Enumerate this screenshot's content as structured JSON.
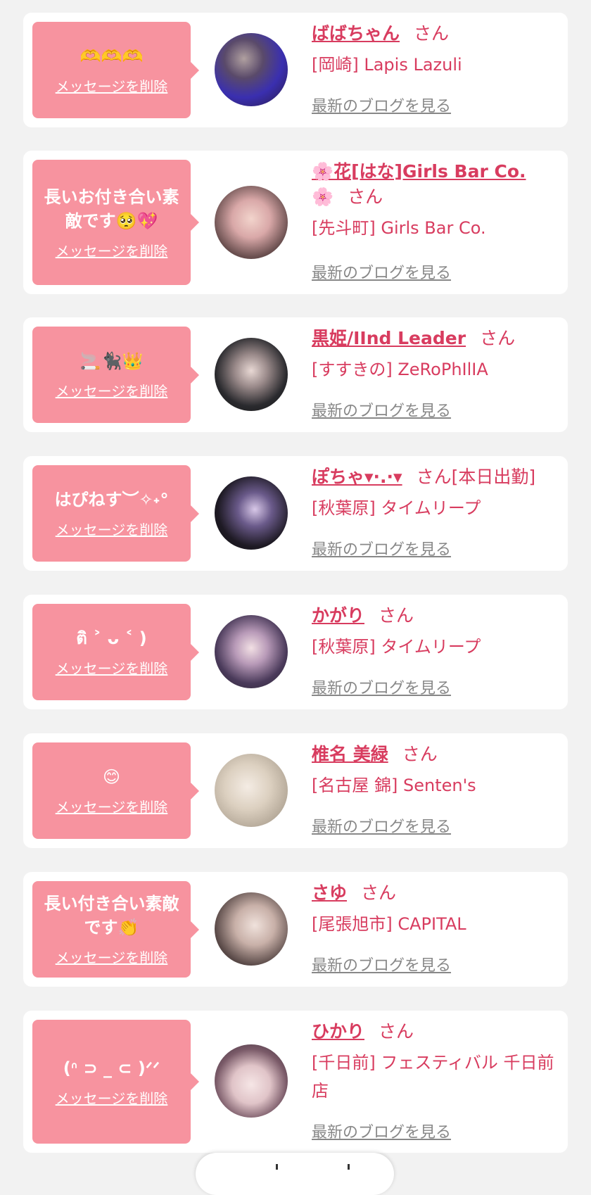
{
  "delete_label": "メッセージを削除",
  "san_label": "さん",
  "blog_label": "最新のブログを見る",
  "cards": [
    {
      "message": "🫶🫶🫶",
      "name": "ばばちゃん",
      "name_suffix": "",
      "badge": "",
      "shop": "[岡崎] Lapis Lazuli"
    },
    {
      "message": "長いお付き合い素敵です🥺💖",
      "name": "🌸花[はな]Girls Bar Co.",
      "name_suffix": "🌸",
      "badge": "",
      "shop": "[先斗町] Girls Bar Co."
    },
    {
      "message": "🚬🐈‍⬛👑",
      "name": "黒姫/IInd Leader",
      "name_suffix": "",
      "badge": "",
      "shop": "[すすきの] ZeRoPhIlIA"
    },
    {
      "message": "はぴねす︶✧˖°",
      "name": "ぽちゃ▾·.·▾",
      "name_suffix": "",
      "badge": "[本日出勤]",
      "shop": "[秋葉原] タイムリープ"
    },
    {
      "message": "ติ ˃ ᴗ ˂ )",
      "name": "かがり",
      "name_suffix": "",
      "badge": "",
      "shop": "[秋葉原] タイムリープ"
    },
    {
      "message": "😊",
      "name": "椎名 美緑",
      "name_suffix": "",
      "badge": "",
      "shop": "[名古屋 錦] Senten's"
    },
    {
      "message": "長い付き合い素敵です👏",
      "name": "さゆ",
      "name_suffix": "",
      "badge": "",
      "shop": "[尾張旭市] CAPITAL"
    },
    {
      "message": "(ᐢ ⊃ _ ⊂ )ᐟᐟ",
      "name": "ひかり",
      "name_suffix": "",
      "badge": "",
      "shop": "[千日前] フェスティバル 千日前店"
    }
  ],
  "colors": {
    "accent": "#d83c5f",
    "bubble": "#f7939f",
    "background": "#f2f2f2"
  }
}
